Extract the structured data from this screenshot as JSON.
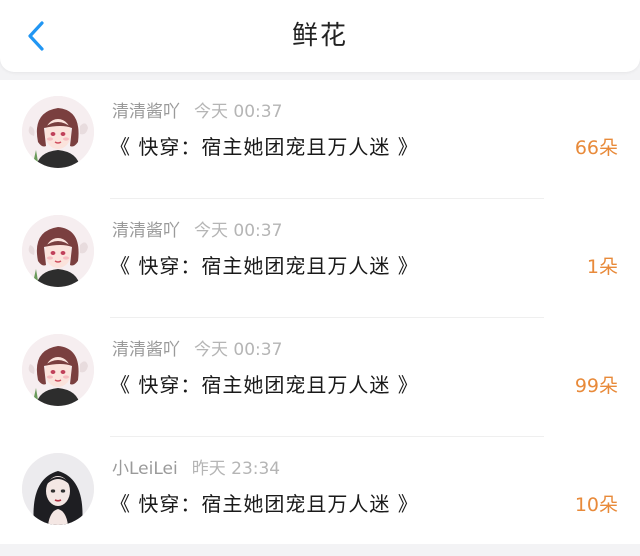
{
  "header": {
    "title": "鲜花"
  },
  "colors": {
    "accent": "#2196f3",
    "count": "#e88a3a"
  },
  "records": [
    {
      "user": "清清酱吖",
      "time": "今天 00:37",
      "book": "《 快穿：宿主她团宠且万人迷 》",
      "count": "66朵",
      "avatar": "girl-avatar-1"
    },
    {
      "user": "清清酱吖",
      "time": "今天 00:37",
      "book": "《 快穿：宿主她团宠且万人迷 》",
      "count": "1朵",
      "avatar": "girl-avatar-1"
    },
    {
      "user": "清清酱吖",
      "time": "今天 00:37",
      "book": "《 快穿：宿主她团宠且万人迷 》",
      "count": "99朵",
      "avatar": "girl-avatar-1"
    },
    {
      "user": "小LeiLei",
      "time": "昨天 23:34",
      "book": "《 快穿：宿主她团宠且万人迷 》",
      "count": "10朵",
      "avatar": "girl-avatar-2"
    }
  ]
}
